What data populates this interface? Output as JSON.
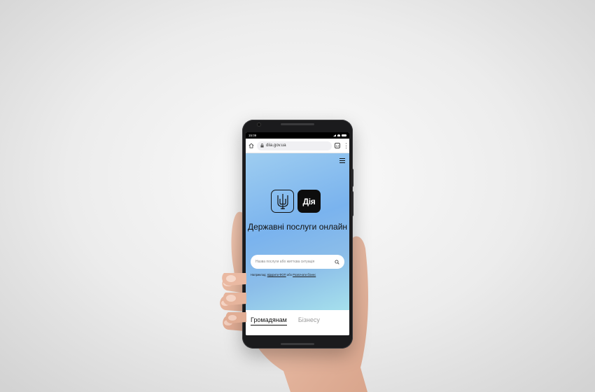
{
  "statusbar": {
    "time": "15:09"
  },
  "browser": {
    "url": "diia.gov.ua",
    "tab_count": "13"
  },
  "site": {
    "logo_text": "Дія",
    "title": "Державні послуги онлайн",
    "search": {
      "placeholder": "Назва послуги або життєва ситуація"
    },
    "example": {
      "prefix": "Наприклад: ",
      "link1": "відкрити ФОП",
      "middle": " або ",
      "link2": "Розпочати бізнес"
    },
    "tabs": [
      {
        "label": "Громадянам",
        "active": true
      },
      {
        "label": "Бізнесу",
        "active": false
      }
    ]
  },
  "colors": {
    "hero_gradient_start": "#9ecdf0",
    "hero_gradient_end": "#a6e0ec",
    "logo_background": "#0d0d0d",
    "phone_body": "#1b1b1d"
  }
}
